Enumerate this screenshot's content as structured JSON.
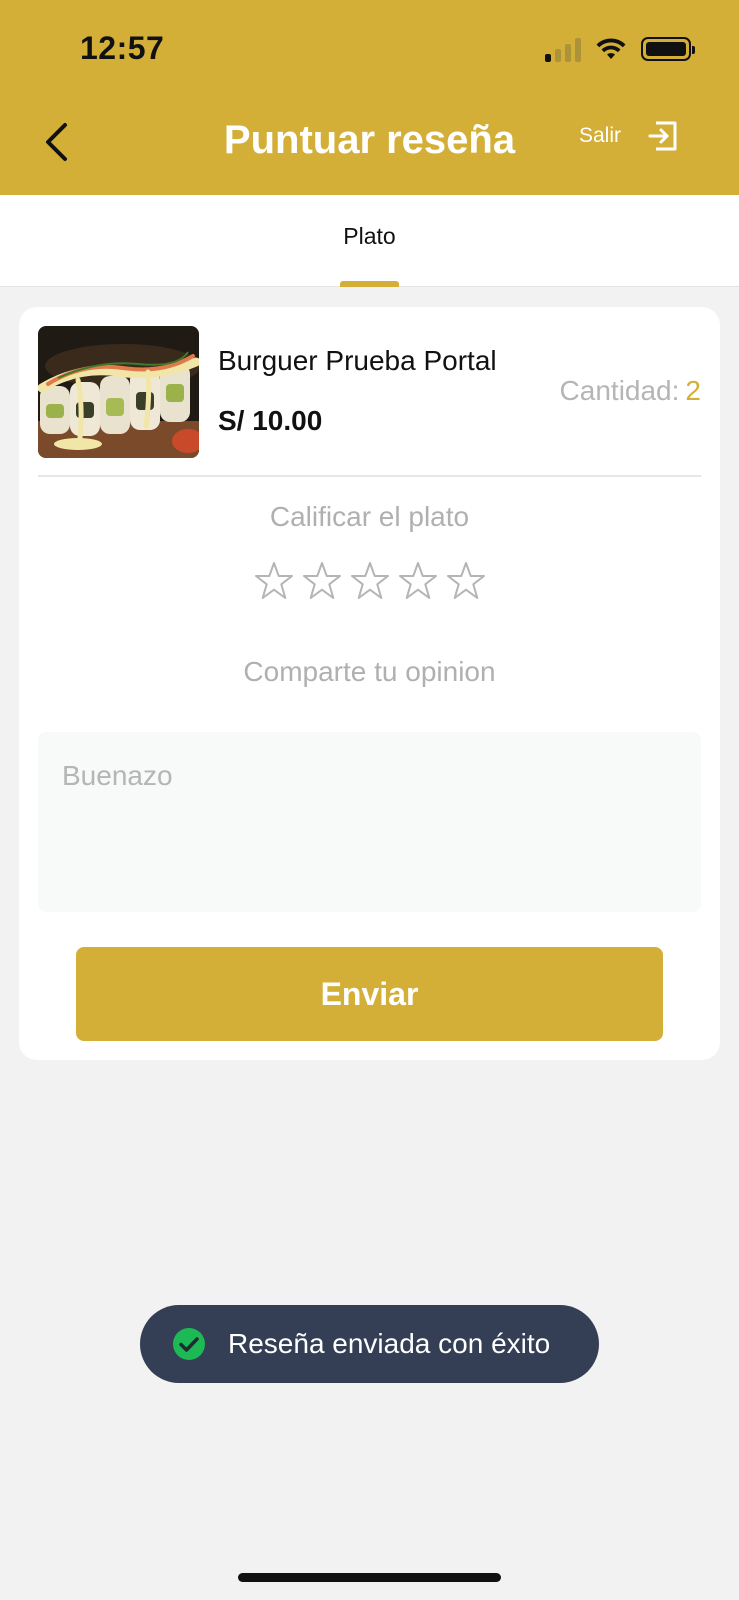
{
  "status_bar": {
    "time": "12:57"
  },
  "header": {
    "title": "Puntuar reseña",
    "logout_label": "Salir",
    "back_icon": "chevron-left-icon",
    "logout_icon": "logout-icon"
  },
  "tabs": [
    {
      "label": "Plato",
      "active": true
    }
  ],
  "dish": {
    "name": "Burguer Prueba Portal",
    "price": "S/ 10.00",
    "quantity_label": "Cantidad:",
    "quantity_value": "2"
  },
  "rating": {
    "label": "Calificar el plato",
    "max_stars": 5,
    "selected": 0
  },
  "opinion": {
    "label": "Comparte tu opinion",
    "placeholder": "Buenazo",
    "value": ""
  },
  "submit": {
    "label": "Enviar"
  },
  "toast": {
    "message": "Reseña enviada con éxito",
    "icon": "check-circle-icon"
  },
  "colors": {
    "accent": "#d4af37",
    "toast_bg": "#343f55",
    "success": "#1db954"
  }
}
